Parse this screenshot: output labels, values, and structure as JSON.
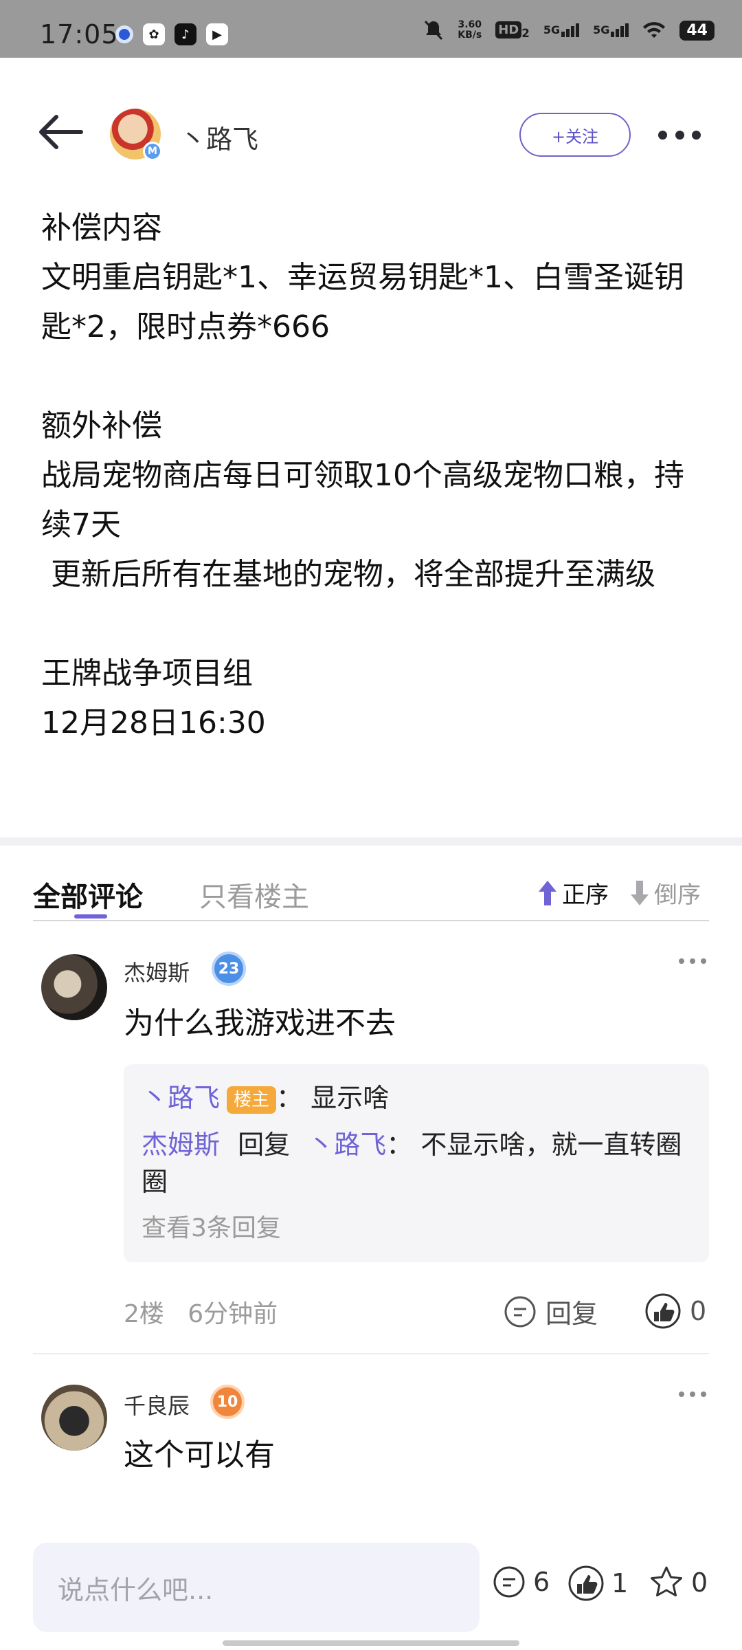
{
  "status_bar": {
    "time": "17:05",
    "net_speed_value": "3.60",
    "net_speed_unit": "KB/s",
    "hd_label": "HD",
    "hd_sub": "2",
    "sim1": "5G",
    "sim2": "5G",
    "battery": "44"
  },
  "header": {
    "author_name": "丶路飞",
    "avatar_badge": "M",
    "follow_label": "+关注"
  },
  "post": {
    "lines": [
      "补偿内容",
      "文明重启钥匙*1、幸运贸易钥匙*1、白雪圣诞钥匙*2，限时点券*666",
      "",
      "额外补偿",
      "战局宠物商店每日可领取10个高级宠物口粮，持续7天",
      " 更新后所有在基地的宠物，将全部提升至满级",
      "",
      "王牌战争项目组",
      "12月28日16:30"
    ]
  },
  "tabs": {
    "all": "全部评论",
    "owner_only": "只看楼主",
    "sort_asc": "正序",
    "sort_desc": "倒序"
  },
  "comments": [
    {
      "user": "杰姆斯",
      "level": "23",
      "text": "为什么我游戏进不去",
      "replies": [
        {
          "from": "丶路飞",
          "owner_badge": "楼主",
          "sep": "：",
          "text": "显示啥"
        },
        {
          "from": "杰姆斯",
          "verb": "回复",
          "to": "丶路飞",
          "sep": "：",
          "text": "不显示啥，就一直转圈圈"
        }
      ],
      "more_replies": "查看3条回复",
      "floor": "2楼",
      "time": "6分钟前",
      "reply_label": "回复",
      "likes": "0"
    },
    {
      "user": "千良辰",
      "level": "10",
      "text": "这个可以有"
    }
  ],
  "bottom": {
    "input_placeholder": "说点什么吧...",
    "comment_count": "6",
    "like_count": "1",
    "star_count": "0"
  },
  "colors": {
    "accent": "#6f63d6",
    "owner_badge": "#f6a93b",
    "status_bar": "#9a9a9a"
  }
}
